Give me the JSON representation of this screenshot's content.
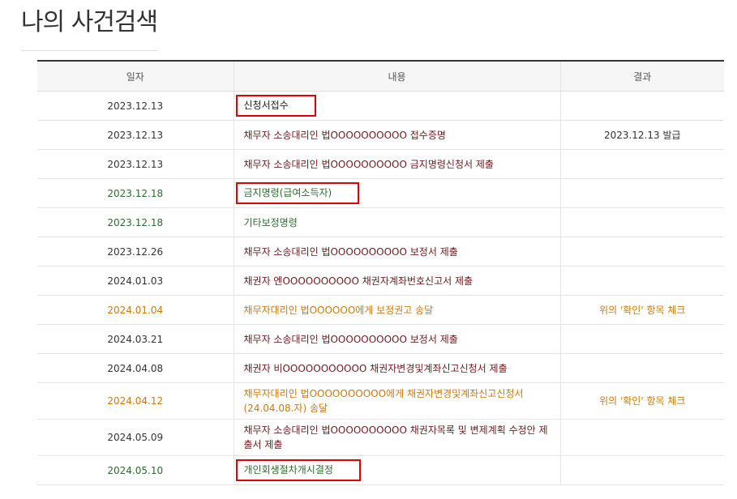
{
  "page": {
    "title": "나의 사건검색"
  },
  "table": {
    "headers": {
      "date": "일자",
      "content": "내용",
      "result": "결과"
    },
    "rows": [
      {
        "date": "2023.12.13",
        "content": "신청서접수",
        "result": ""
      },
      {
        "date": "2023.12.13",
        "content": "채무자 소송대리인 법OOOOOOOOOO 접수증명",
        "result": "2023.12.13 발급"
      },
      {
        "date": "2023.12.13",
        "content": "채무자 소송대리인 법OOOOOOOOOO 금지명령신청서 제출",
        "result": ""
      },
      {
        "date": "2023.12.18",
        "content": "금지명령(급여소득자)",
        "result": ""
      },
      {
        "date": "2023.12.18",
        "content": "기타보정명령",
        "result": ""
      },
      {
        "date": "2023.12.26",
        "content": "채무자 소송대리인 법OOOOOOOOOO 보정서 제출",
        "result": ""
      },
      {
        "date": "2024.01.03",
        "content": "채권자 엔OOOOOOOOOO 채권자계좌번호신고서 제출",
        "result": ""
      },
      {
        "date": "2024.01.04",
        "content": "채무자대리인 법OOOOOO에게 보정권고 송달",
        "result": "위의 '확인' 항목 체크"
      },
      {
        "date": "2024.03.21",
        "content": "채무자 소송대리인 법OOOOOOOOOO 보정서 제출",
        "result": ""
      },
      {
        "date": "2024.04.08",
        "content": "채권자 비OOOOOOOOOOO 채권자변경및계좌신고신청서 제출",
        "result": ""
      },
      {
        "date": "2024.04.12",
        "content": "채무자대리인 법OOOOOOOOOO에게 채권자변경및계좌신고신청서(24.04.08.자) 송달",
        "result": "위의 '확인' 항목 체크"
      },
      {
        "date": "2024.05.09",
        "content": "채무자 소송대리인 법OOOOOOOOOO 채권자목록 및 변제계획 수정안 제출서 제출",
        "result": ""
      },
      {
        "date": "2024.05.10",
        "content": "개인회생절차개시결정",
        "result": ""
      }
    ]
  },
  "colors": {
    "default_content": "#6b1b1b",
    "court_decision": "#2e6b2e",
    "delivery": "#cc7a0e",
    "highlight_box": "#e00000",
    "header_border": "#333333"
  }
}
